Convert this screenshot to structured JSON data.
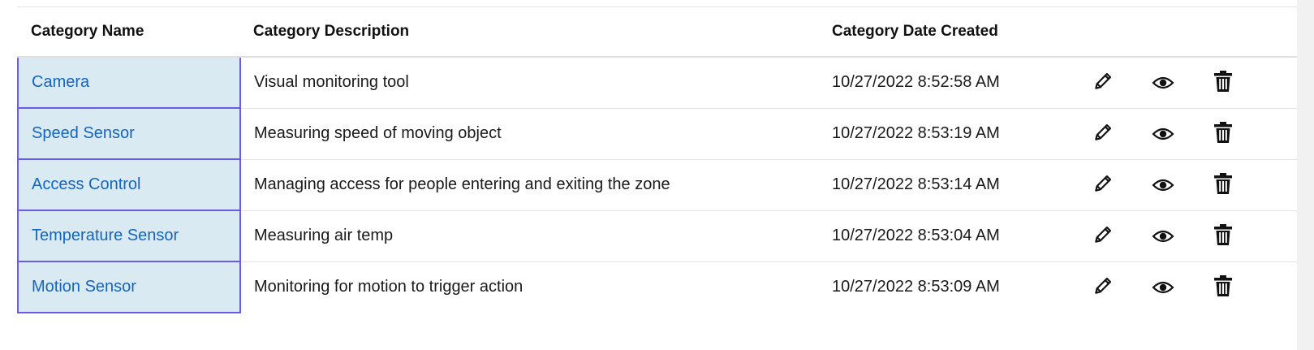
{
  "table": {
    "headers": {
      "name": "Category Name",
      "description": "Category Description",
      "date_created": "Category Date Created"
    },
    "rows": [
      {
        "name": "Camera",
        "description": "Visual monitoring tool",
        "date_created": "10/27/2022 8:52:58 AM"
      },
      {
        "name": "Speed Sensor",
        "description": "Measuring speed of moving object",
        "date_created": "10/27/2022 8:53:19 AM"
      },
      {
        "name": "Access Control",
        "description": "Managing access for people entering and exiting the zone",
        "date_created": "10/27/2022 8:53:14 AM"
      },
      {
        "name": "Temperature Sensor",
        "description": "Measuring air temp",
        "date_created": "10/27/2022 8:53:04 AM"
      },
      {
        "name": "Motion Sensor",
        "description": "Monitoring for motion to trigger action",
        "date_created": "10/27/2022 8:53:09 AM"
      }
    ],
    "row_actions": [
      {
        "icon": "pencil-icon",
        "action": "edit"
      },
      {
        "icon": "eye-icon",
        "action": "view"
      },
      {
        "icon": "trash-icon",
        "action": "delete"
      }
    ]
  },
  "colors": {
    "link": "#1565c0",
    "selected_cell_bg": "#daeaf2",
    "selected_cell_border": "#6a5ce6"
  }
}
